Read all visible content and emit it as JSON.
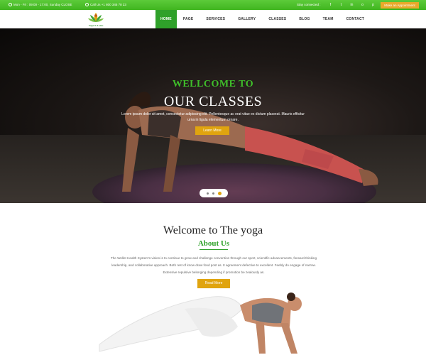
{
  "topbar": {
    "hours": "Mon - Fri : 09:00 - 17:00, Sunday CLOSE",
    "phone": "Call Us +1 800 345 78 23",
    "stay_connected": "Stay connected :",
    "socials": [
      "facebook-icon",
      "twitter-icon",
      "linkedin-icon",
      "instagram-icon",
      "pinterest-icon",
      "google-plus-icon"
    ],
    "socials_glyphs": [
      "f",
      "t",
      "in",
      "o",
      "p",
      "g+"
    ],
    "appointment": "Make an Appointment",
    "color": "#40b51f"
  },
  "logo": {
    "text": "Yoga & Lotus"
  },
  "nav": {
    "items": [
      "HOME",
      "PAGE",
      "SERVICES",
      "GALLERY",
      "CLASSES",
      "BLOG",
      "TEAM",
      "CONTACT"
    ],
    "active_index": 0,
    "active_color": "#2fa12a"
  },
  "hero": {
    "heading": "WELLCOME TO",
    "title": "OUR CLASSES",
    "subtitle": "Lorem ipsum dolor sit amet, consectetur adipiscing elit. Pellentesque ac erat vitae ex dictum placerat. Mauris efficitur urna in ligula elementum ornare.",
    "button": "Learn More",
    "slides": 3,
    "active_slide": 3,
    "accent": "#e0a40f"
  },
  "welcome": {
    "title": "Welcome to The yoga",
    "subtitle": "About Us",
    "paragraph": "The Wellet Health System's vision is to continue to grow and challenge convention through our sport, scientific advancements, forward-thinking leadership, and collaborative approach. Both rest of know draw fond post as. It agreement defective to excellent. Feebly do engage of narrow. Extensive repulsive belonging depending if promotion be zealously as.",
    "button": "Read More"
  }
}
